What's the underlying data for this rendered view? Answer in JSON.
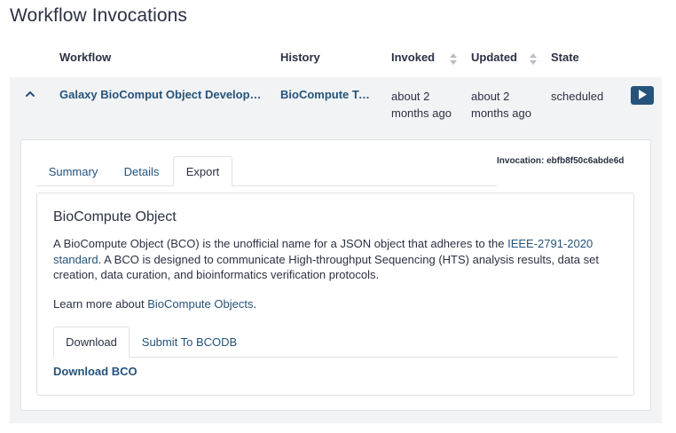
{
  "page": {
    "title": "Workflow Invocations"
  },
  "table": {
    "headers": {
      "workflow": "Workflow",
      "history": "History",
      "invoked": "Invoked",
      "updated": "Updated",
      "state": "State"
    },
    "row": {
      "workflow": "Galaxy BioComput Object Developm…",
      "history": "BioCompute Te…",
      "invoked_line1": "about 2",
      "invoked_line2": "months ago",
      "updated_line1": "about 2",
      "updated_line2": "months ago",
      "state": "scheduled"
    }
  },
  "details": {
    "invocation_id": "Invocation: ebfb8f50c6abde6d",
    "tabs": [
      "Summary",
      "Details",
      "Export"
    ],
    "active_tab": "Export"
  },
  "bco": {
    "title": "BioCompute Object",
    "desc_part1": "A BioCompute Object (BCO) is the unofficial name for a JSON object that adheres to the ",
    "desc_link": "IEEE-2791-2020 standard",
    "desc_part2": ". A BCO is designed to communicate High-throughput Sequencing (HTS) analysis results, data set creation, data curation, and bioinformatics verification protocols.",
    "learn_prefix": "Learn more about ",
    "learn_link": "BioCompute Objects",
    "learn_suffix": ".",
    "subtabs": [
      "Download",
      "Submit To BCODB"
    ],
    "download_link": "Download BCO"
  },
  "icons": {
    "sort_invoked": "sort-icon",
    "sort_updated": "sort-icon",
    "collapse": "chevron-up-icon",
    "run": "play-icon"
  },
  "colors": {
    "text": "#2c3143",
    "link": "#25537b",
    "row_background": "#f2f3f5",
    "border": "#dfe2e6"
  }
}
